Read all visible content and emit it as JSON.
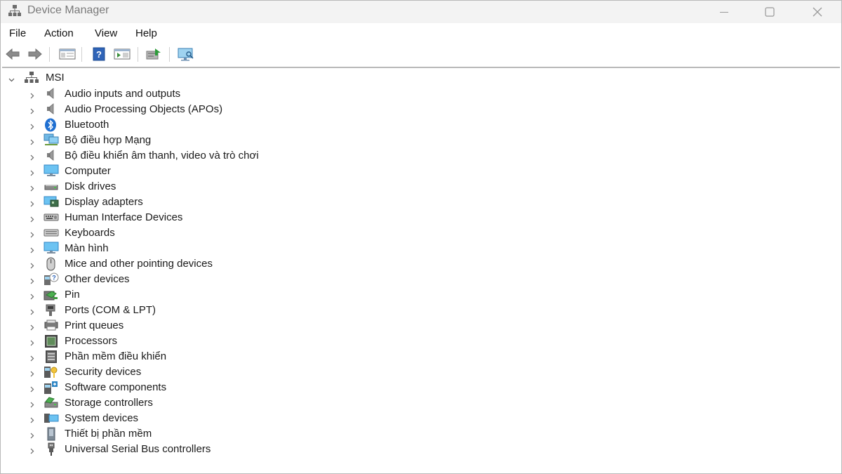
{
  "window": {
    "title": "Device Manager"
  },
  "menu": [
    "File",
    "Action",
    "View",
    "Help"
  ],
  "tree": {
    "root": "MSI",
    "items": [
      {
        "label": "Audio inputs and outputs",
        "icon": "speaker-icon"
      },
      {
        "label": "Audio Processing Objects (APOs)",
        "icon": "speaker-icon"
      },
      {
        "label": "Bluetooth",
        "icon": "bluetooth-icon"
      },
      {
        "label": "Bộ điều hợp Mạng",
        "icon": "network-adapter-icon"
      },
      {
        "label": "Bộ điều khiển âm thanh, video và trò chơi",
        "icon": "speaker-icon"
      },
      {
        "label": "Computer",
        "icon": "monitor-icon"
      },
      {
        "label": "Disk drives",
        "icon": "disk-drive-icon"
      },
      {
        "label": "Display adapters",
        "icon": "display-adapter-icon"
      },
      {
        "label": "Human Interface Devices",
        "icon": "hid-icon"
      },
      {
        "label": "Keyboards",
        "icon": "keyboard-icon"
      },
      {
        "label": "Màn hình",
        "icon": "monitor-icon"
      },
      {
        "label": "Mice and other pointing devices",
        "icon": "mouse-icon"
      },
      {
        "label": "Other devices",
        "icon": "unknown-device-icon"
      },
      {
        "label": "Pin",
        "icon": "battery-icon"
      },
      {
        "label": "Ports (COM & LPT)",
        "icon": "port-icon"
      },
      {
        "label": "Print queues",
        "icon": "printer-icon"
      },
      {
        "label": "Processors",
        "icon": "processor-icon"
      },
      {
        "label": "Phần mềm điều khiển",
        "icon": "firmware-icon"
      },
      {
        "label": "Security devices",
        "icon": "security-key-icon"
      },
      {
        "label": "Software components",
        "icon": "software-component-icon"
      },
      {
        "label": "Storage controllers",
        "icon": "storage-controller-icon"
      },
      {
        "label": "System devices",
        "icon": "system-device-icon"
      },
      {
        "label": "Thiết bị phần mềm",
        "icon": "software-device-icon"
      },
      {
        "label": "Universal Serial Bus controllers",
        "icon": "usb-icon"
      }
    ]
  }
}
